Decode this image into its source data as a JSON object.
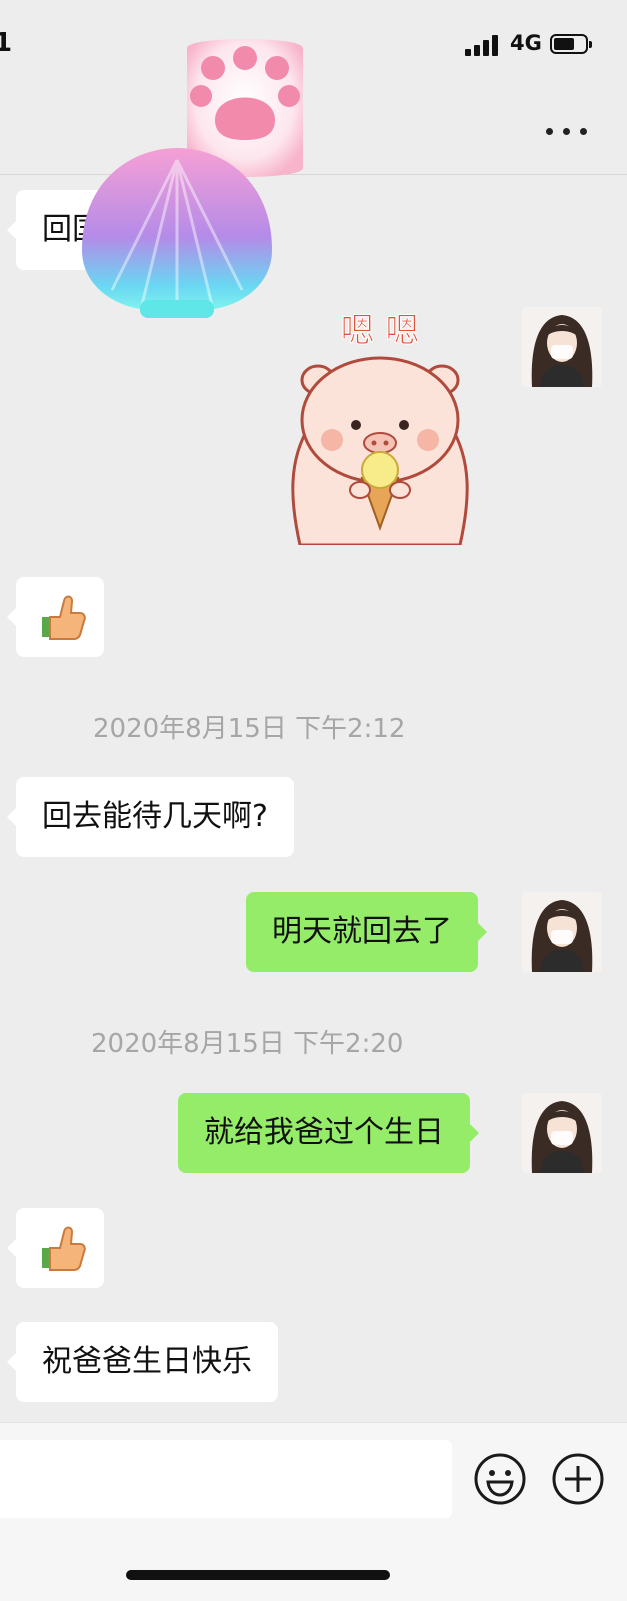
{
  "status_bar": {
    "time": "1",
    "network": "4G"
  },
  "nav": {
    "more_icon": "more-dots-icon"
  },
  "messages": [
    {
      "side": "in",
      "type": "text",
      "text": "回国"
    },
    {
      "side": "out",
      "type": "sticker",
      "sticker_text": "嗯 嗯",
      "sticker": "pig-eating-ice-cream-sticker"
    },
    {
      "side": "in",
      "type": "emoji",
      "emoji": "👍"
    },
    {
      "type": "timestamp",
      "text": "2020年8月15日 下午2:12"
    },
    {
      "side": "in",
      "type": "text",
      "text": "回去能待几天啊?"
    },
    {
      "side": "out",
      "type": "text",
      "text": "明天就回去了"
    },
    {
      "type": "timestamp",
      "text": "2020年8月15日 下午2:20"
    },
    {
      "side": "out",
      "type": "text",
      "text": "就给我爸过个生日"
    },
    {
      "side": "in",
      "type": "emoji",
      "emoji": "👍"
    },
    {
      "side": "in",
      "type": "text",
      "text": "祝爸爸生日快乐"
    }
  ],
  "overlays": [
    "paw-sticker",
    "shell-sticker"
  ],
  "input_bar": {
    "placeholder": "",
    "emoji_icon": "smiley-face-icon",
    "plus_icon": "plus-circle-icon"
  },
  "colors": {
    "background": "#ededed",
    "incoming_bubble": "#ffffff",
    "outgoing_bubble": "#95ec69",
    "timestamp": "#a6a6a6"
  }
}
